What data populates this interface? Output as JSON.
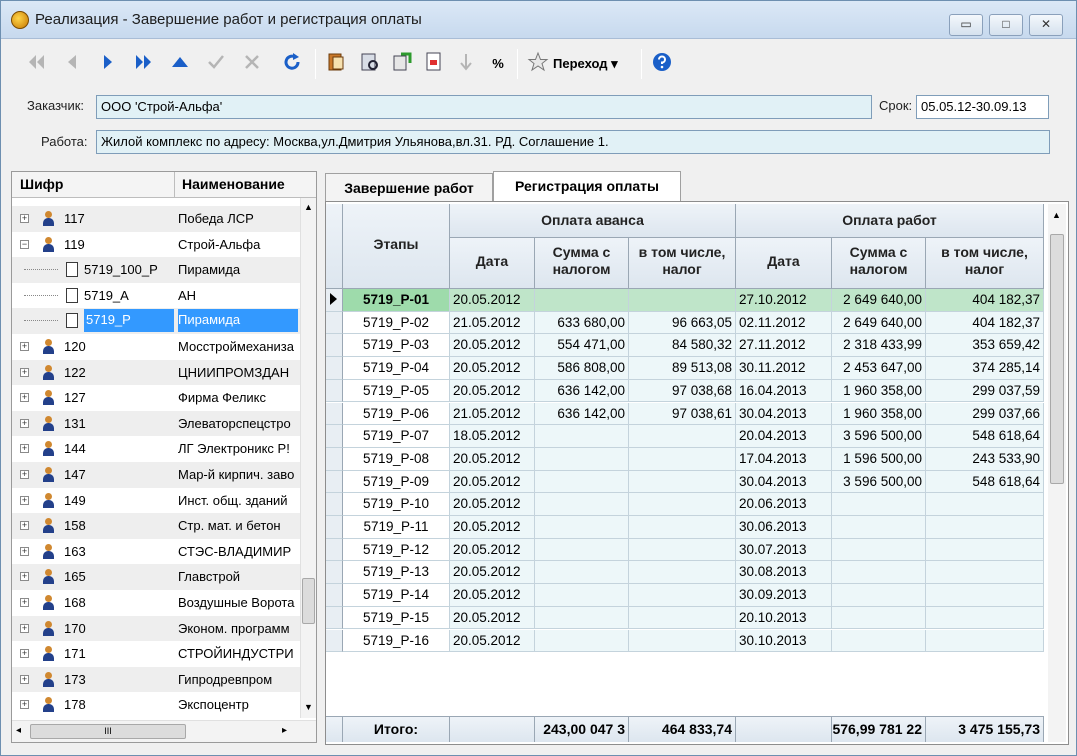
{
  "window": {
    "title": "Реализация - Завершение работ и регистрация оплаты",
    "minimize": "▭",
    "maximize": "□",
    "close": "✕"
  },
  "toolbar": {
    "percent_label": "%",
    "goto_label": "Переход",
    "goto_arrow": "▾"
  },
  "info": {
    "customer_label": "Заказчик:",
    "customer_value": "ООО 'Строй-Альфа'",
    "term_label": "Срок:",
    "term_value": "05.05.12-30.09.13",
    "work_label": "Работа:",
    "work_value": "Жилой комплекс по адресу: Москва,ул.Дмитрия Ульянова,вл.31. РД. Соглашение 1."
  },
  "tree": {
    "col_code": "Шифр",
    "col_name": "Наименование",
    "rows": [
      {
        "code": "117",
        "name": "Победа ЛСР",
        "kind": "org",
        "level": 0,
        "exp": "+"
      },
      {
        "code": "119",
        "name": "Строй-Альфа",
        "kind": "org",
        "level": 0,
        "exp": "−"
      },
      {
        "code": "5719_100_P",
        "name": "Пирамида",
        "kind": "doc",
        "level": 1,
        "exp": ""
      },
      {
        "code": "5719_A",
        "name": "АН",
        "kind": "doc",
        "level": 1,
        "exp": ""
      },
      {
        "code": "5719_P",
        "name": "Пирамида",
        "kind": "doc",
        "level": 1,
        "exp": "",
        "selected": true
      },
      {
        "code": "120",
        "name": "Мосстроймеханиза",
        "kind": "org",
        "level": 0,
        "exp": "+"
      },
      {
        "code": "122",
        "name": "ЦНИИПРОМЗДАН",
        "kind": "org",
        "level": 0,
        "exp": "+"
      },
      {
        "code": "127",
        "name": "Фирма Феликс",
        "kind": "org",
        "level": 0,
        "exp": "+"
      },
      {
        "code": "131",
        "name": "Элеваторспецстро",
        "kind": "org",
        "level": 0,
        "exp": "+"
      },
      {
        "code": "144",
        "name": "ЛГ Электроникс Р!",
        "kind": "org",
        "level": 0,
        "exp": "+"
      },
      {
        "code": "147",
        "name": "Мар-й кирпич. заво",
        "kind": "org",
        "level": 0,
        "exp": "+"
      },
      {
        "code": "149",
        "name": "Инст. общ. зданий",
        "kind": "org",
        "level": 0,
        "exp": "+"
      },
      {
        "code": "158",
        "name": "Стр. мат. и бетон",
        "kind": "org",
        "level": 0,
        "exp": "+"
      },
      {
        "code": "163",
        "name": "СТЭС-ВЛАДИМИР",
        "kind": "org",
        "level": 0,
        "exp": "+"
      },
      {
        "code": "165",
        "name": "Главстрой",
        "kind": "org",
        "level": 0,
        "exp": "+"
      },
      {
        "code": "168",
        "name": "Воздушные Ворота",
        "kind": "org",
        "level": 0,
        "exp": "+"
      },
      {
        "code": "170",
        "name": "Эконом. программ",
        "kind": "org",
        "level": 0,
        "exp": "+"
      },
      {
        "code": "171",
        "name": "СТРОЙИНДУСТРИ",
        "kind": "org",
        "level": 0,
        "exp": "+"
      },
      {
        "code": "173",
        "name": "Гипродревпром",
        "kind": "org",
        "level": 0,
        "exp": "+"
      },
      {
        "code": "178",
        "name": "Экспоцентр",
        "kind": "org",
        "level": 0,
        "exp": "+"
      }
    ],
    "hscroll_grip": "III"
  },
  "tabs": [
    {
      "label": "Завершение работ",
      "active": false
    },
    {
      "label": "Регистрация оплаты",
      "active": true
    }
  ],
  "grid": {
    "col_stage": "Этапы",
    "group_advance": "Оплата аванса",
    "group_work": "Оплата работ",
    "col_date": "Дата",
    "col_sum": "Сумма с налогом",
    "col_tax": "в том числе, налог",
    "rows": [
      [
        "5719_P-01",
        "20.05.2012",
        "",
        "",
        "27.10.2012",
        "2 649 640,00",
        "404 182,37"
      ],
      [
        "5719_P-02",
        "21.05.2012",
        "633 680,00",
        "96 663,05",
        "02.11.2012",
        "2 649 640,00",
        "404 182,37"
      ],
      [
        "5719_P-03",
        "20.05.2012",
        "554 471,00",
        "84 580,32",
        "27.11.2012",
        "2 318 433,99",
        "353 659,42"
      ],
      [
        "5719_P-04",
        "20.05.2012",
        "586 808,00",
        "89 513,08",
        "30.11.2012",
        "2 453 647,00",
        "374 285,14"
      ],
      [
        "5719_P-05",
        "20.05.2012",
        "636 142,00",
        "97 038,68",
        "16.04.2013",
        "1 960 358,00",
        "299 037,59"
      ],
      [
        "5719_P-06",
        "21.05.2012",
        "636 142,00",
        "97 038,61",
        "30.04.2013",
        "1 960 358,00",
        "299 037,66"
      ],
      [
        "5719_P-07",
        "18.05.2012",
        "",
        "",
        "20.04.2013",
        "3 596 500,00",
        "548 618,64"
      ],
      [
        "5719_P-08",
        "20.05.2012",
        "",
        "",
        "17.04.2013",
        "1 596 500,00",
        "243 533,90"
      ],
      [
        "5719_P-09",
        "20.05.2012",
        "",
        "",
        "30.04.2013",
        "3 596 500,00",
        "548 618,64"
      ],
      [
        "5719_P-10",
        "20.05.2012",
        "",
        "",
        "20.06.2013",
        "",
        ""
      ],
      [
        "5719_P-11",
        "20.05.2012",
        "",
        "",
        "30.06.2013",
        "",
        ""
      ],
      [
        "5719_P-12",
        "20.05.2012",
        "",
        "",
        "30.07.2013",
        "",
        ""
      ],
      [
        "5719_P-13",
        "20.05.2012",
        "",
        "",
        "30.08.2013",
        "",
        ""
      ],
      [
        "5719_P-14",
        "20.05.2012",
        "",
        "",
        "30.09.2013",
        "",
        ""
      ],
      [
        "5719_P-15",
        "20.05.2012",
        "",
        "",
        "20.10.2013",
        "",
        ""
      ],
      [
        "5719_P-16",
        "20.05.2012",
        "",
        "",
        "30.10.2013",
        "",
        ""
      ]
    ],
    "total_label": "Итого:",
    "total_adv_sum": "3 047 243,00",
    "total_adv_tax": "464 833,74",
    "total_work_sum": "22 781 576,99",
    "total_work_tax": "3 475 155,73"
  }
}
